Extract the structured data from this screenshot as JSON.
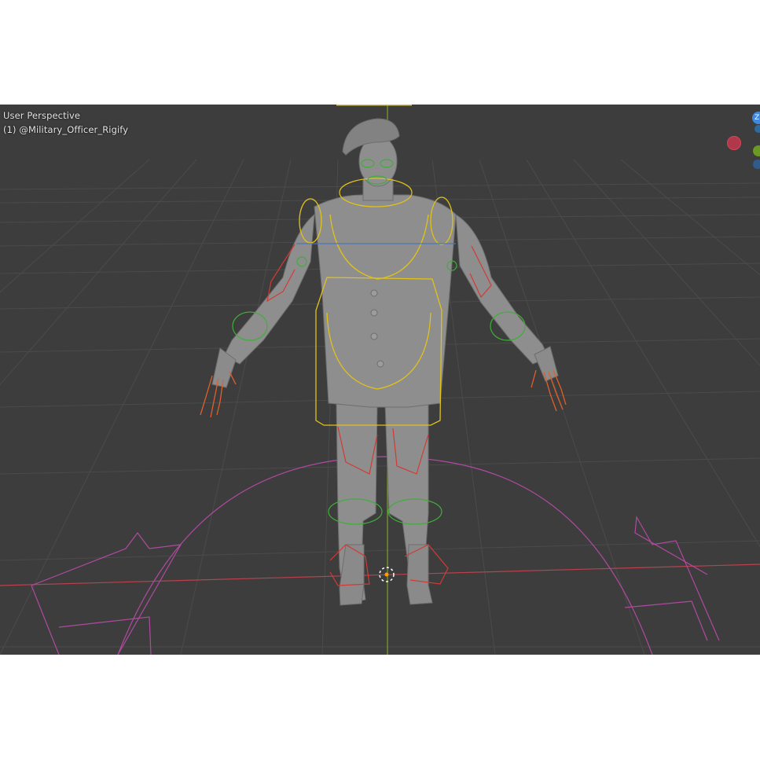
{
  "viewport": {
    "view_name": "User Perspective",
    "object_label": "(1) @Military_Officer_Rigify"
  },
  "gizmo": {
    "z_axis_label": "Z",
    "colors": {
      "x": "#d7455a",
      "y": "#8bc34a",
      "z": "#3f88e0"
    }
  },
  "colors": {
    "viewport_bg": "#3d3d3d",
    "grid": "#4a4a4a",
    "x_axis": "#b9424e",
    "y_axis": "#7fa12a",
    "mesh": "#8e8e8e",
    "bone_yellow": "#e0c21a",
    "bone_red": "#d23a34",
    "bone_green": "#3fae38",
    "bone_orange": "#e0602a",
    "root_control": "#b04aa0"
  },
  "scene": {
    "armature_name": "Military_Officer_Rigify",
    "mode": "object"
  }
}
